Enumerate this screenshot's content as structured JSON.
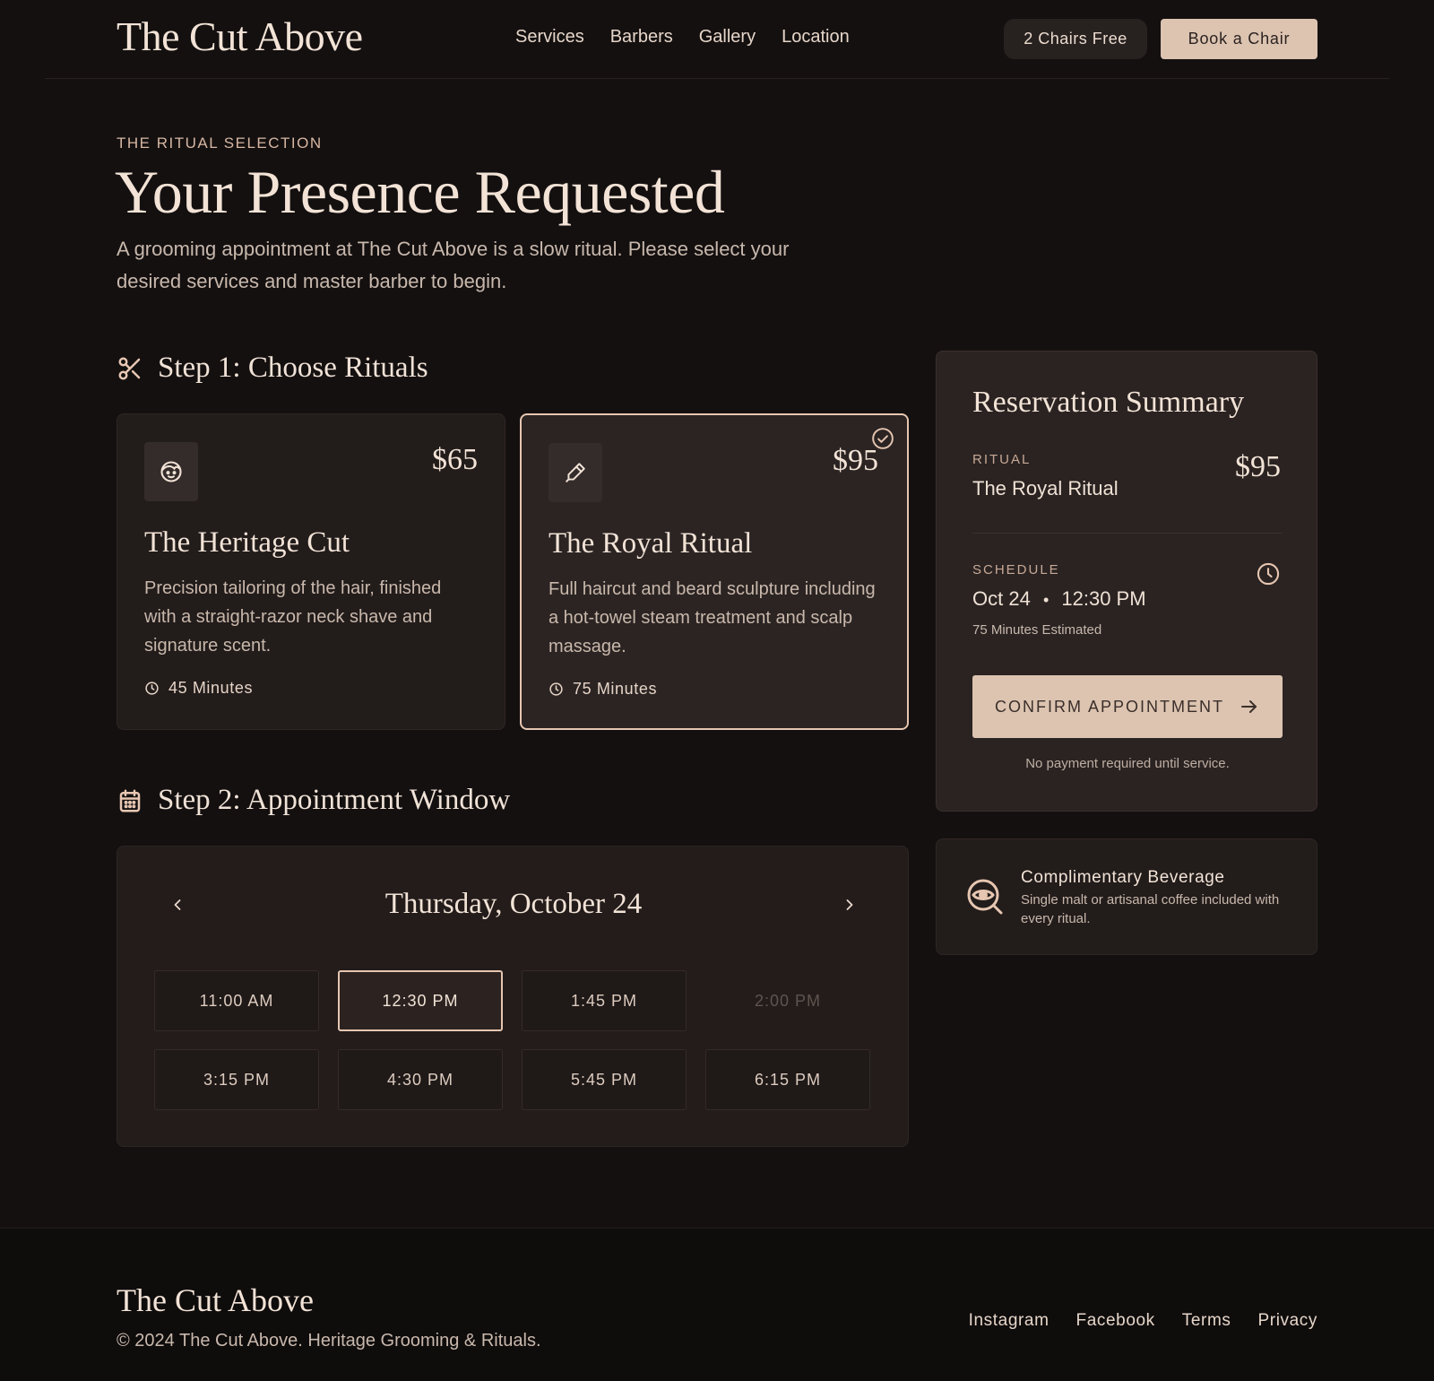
{
  "header": {
    "logo": "The Cut Above",
    "nav": [
      "Services",
      "Barbers",
      "Gallery",
      "Location"
    ],
    "availability": "2 Chairs Free",
    "cta": "Book a Chair"
  },
  "hero": {
    "eyebrow": "THE RITUAL SELECTION",
    "title": "Your Presence Requested",
    "subtitle": "A grooming appointment at The Cut Above is a slow ritual. Please select your desired services and master barber to begin."
  },
  "step1": {
    "title": "Step 1: Choose Rituals",
    "icon": "scissors-icon",
    "cards": [
      {
        "icon": "face-icon",
        "price": "$65",
        "title": "The Heritage Cut",
        "description": "Precision tailoring of the hair, finished with a straight-razor neck shave and signature scent.",
        "duration": "45 Minutes",
        "selected": false
      },
      {
        "icon": "razor-icon",
        "price": "$95",
        "title": "The Royal Ritual",
        "description": "Full haircut and beard sculpture including a hot-towel steam treatment and scalp massage.",
        "duration": "75 Minutes",
        "selected": true
      }
    ]
  },
  "step2": {
    "title": "Step 2: Appointment Window",
    "icon": "calendar-icon",
    "date": "Thursday, October 24",
    "slots": [
      {
        "time": "11:00 AM",
        "state": "available"
      },
      {
        "time": "12:30 PM",
        "state": "selected"
      },
      {
        "time": "1:45 PM",
        "state": "available"
      },
      {
        "time": "2:00 PM",
        "state": "disabled"
      },
      {
        "time": "3:15 PM",
        "state": "available"
      },
      {
        "time": "4:30 PM",
        "state": "available"
      },
      {
        "time": "5:45 PM",
        "state": "available"
      },
      {
        "time": "6:15 PM",
        "state": "available"
      }
    ]
  },
  "summary": {
    "title": "Reservation Summary",
    "ritual_label": "RITUAL",
    "ritual_value": "The Royal Ritual",
    "price": "$95",
    "schedule_label": "SCHEDULE",
    "schedule_date": "Oct 24",
    "schedule_time": "12:30 PM",
    "estimate": "75 Minutes Estimated",
    "confirm": "CONFIRM APPOINTMENT",
    "note": "No payment required until service."
  },
  "beverage": {
    "title": "Complimentary Beverage",
    "description": "Single malt or artisanal coffee included with every ritual."
  },
  "footer": {
    "logo": "The Cut Above",
    "copyright": "© 2024 The Cut Above. Heritage Grooming & Rituals.",
    "links": [
      "Instagram",
      "Facebook",
      "Terms",
      "Privacy"
    ]
  },
  "colors": {
    "background": "#141010",
    "accent": "#dcc4b1",
    "highlight": "#e6c6b1",
    "text": "#f2e3d6"
  }
}
